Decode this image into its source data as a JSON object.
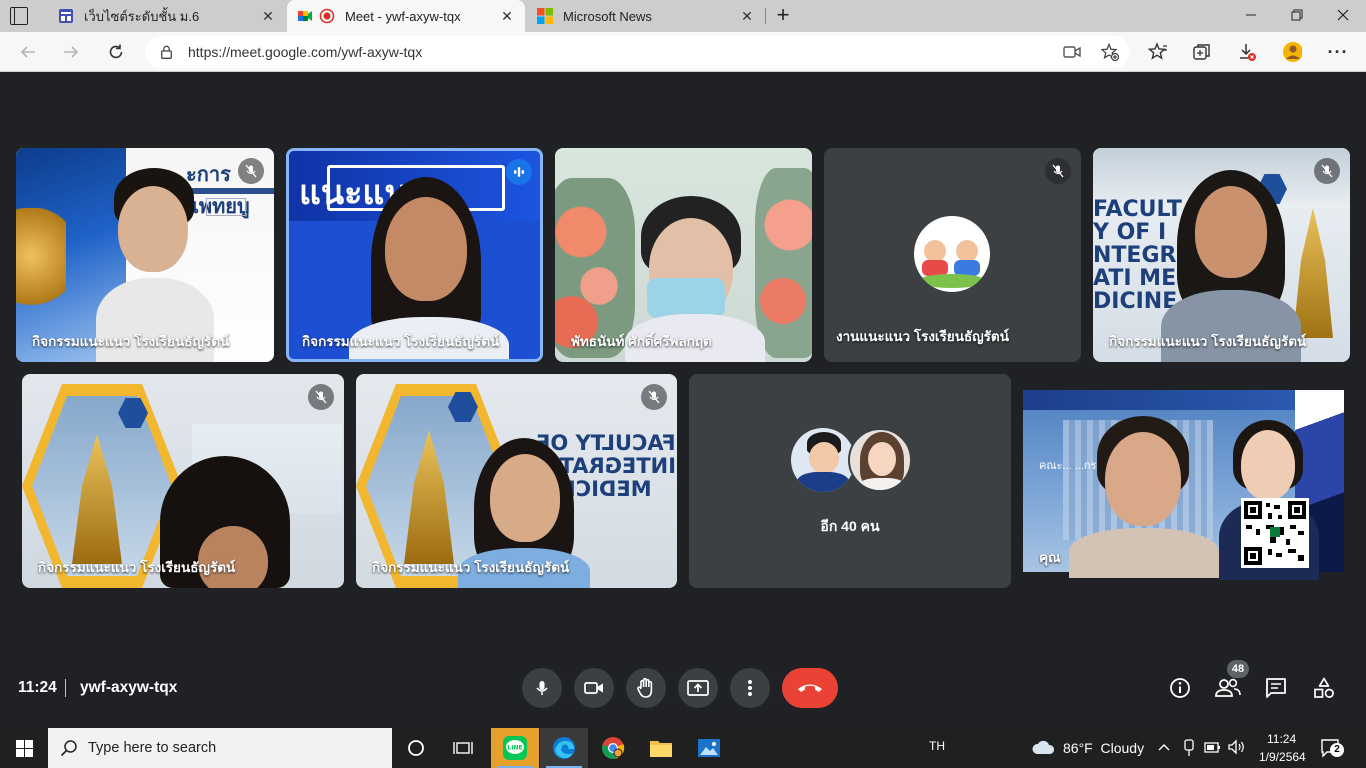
{
  "browser": {
    "tabs": [
      {
        "title": "เว็บไซต์ระดับชั้น ม.6",
        "active": false
      },
      {
        "title": "Meet - ywf-axyw-tqx",
        "active": true
      },
      {
        "title": "Microsoft News",
        "active": false
      }
    ],
    "url": "https://meet.google.com/ywf-axyw-tqx"
  },
  "tiles": [
    {
      "name": "กิจกรรมแนะแนว โรงเรียนธัญรัตน์",
      "muted": true,
      "speaking": false,
      "banner_text": "ะการแพทยบู"
    },
    {
      "name": "กิจกรรมแนะแนว โรงเรียนธัญรัตน์",
      "muted": false,
      "speaking": true,
      "banner_text": "แนะแนว"
    },
    {
      "name": "พัทธนันท์ ศักดิ์ศรีพลกฤต",
      "muted": false,
      "speaking": false
    },
    {
      "name": "งานแนะแนว โรงเรียนธัญรัตน์",
      "muted": true,
      "speaking": false
    },
    {
      "name": "กิจกรรมแนะแนว โรงเรียนธัญรัตน์",
      "muted": true,
      "speaking": false,
      "banner_text": "FACULTY OF INTEGRATI MEDICINE"
    },
    {
      "name": "กิจกรรมแนะแนว โรงเรียนธัญรัตน์",
      "muted": true,
      "speaking": false
    },
    {
      "name": "กิจกรรมแนะแนว โรงเรียนธัญรัตน์",
      "muted": true,
      "speaking": false,
      "banner_text": "FACULTY OF INTEGRATIV MEDICINE"
    },
    {
      "name": "อีก 40 คน",
      "muted": false,
      "speaking": false
    },
    {
      "name": "คุณ",
      "muted": false,
      "speaking": false,
      "banner_text": "คณะ... ...กรรม"
    }
  ],
  "meeting": {
    "time": "11:24",
    "code": "ywf-axyw-tqx",
    "participant_count": "48"
  },
  "controls": {
    "icons": [
      "mic-icon",
      "camera-icon",
      "raise-hand-icon",
      "present-icon",
      "more-icon",
      "end-call-icon"
    ],
    "right_icons": [
      "info-icon",
      "people-icon",
      "chat-icon",
      "activities-icon"
    ]
  },
  "taskbar": {
    "search_placeholder": "Type here to search",
    "language": "TH",
    "weather": "86°F  Cloudy",
    "time": "11:24",
    "date": "1/9/2564",
    "notifications": "2"
  },
  "colors": {
    "meet_background": "#202124",
    "tile_background": "#3c4043",
    "end_call": "#ea4335",
    "speaking_border": "#8ab4f8"
  }
}
